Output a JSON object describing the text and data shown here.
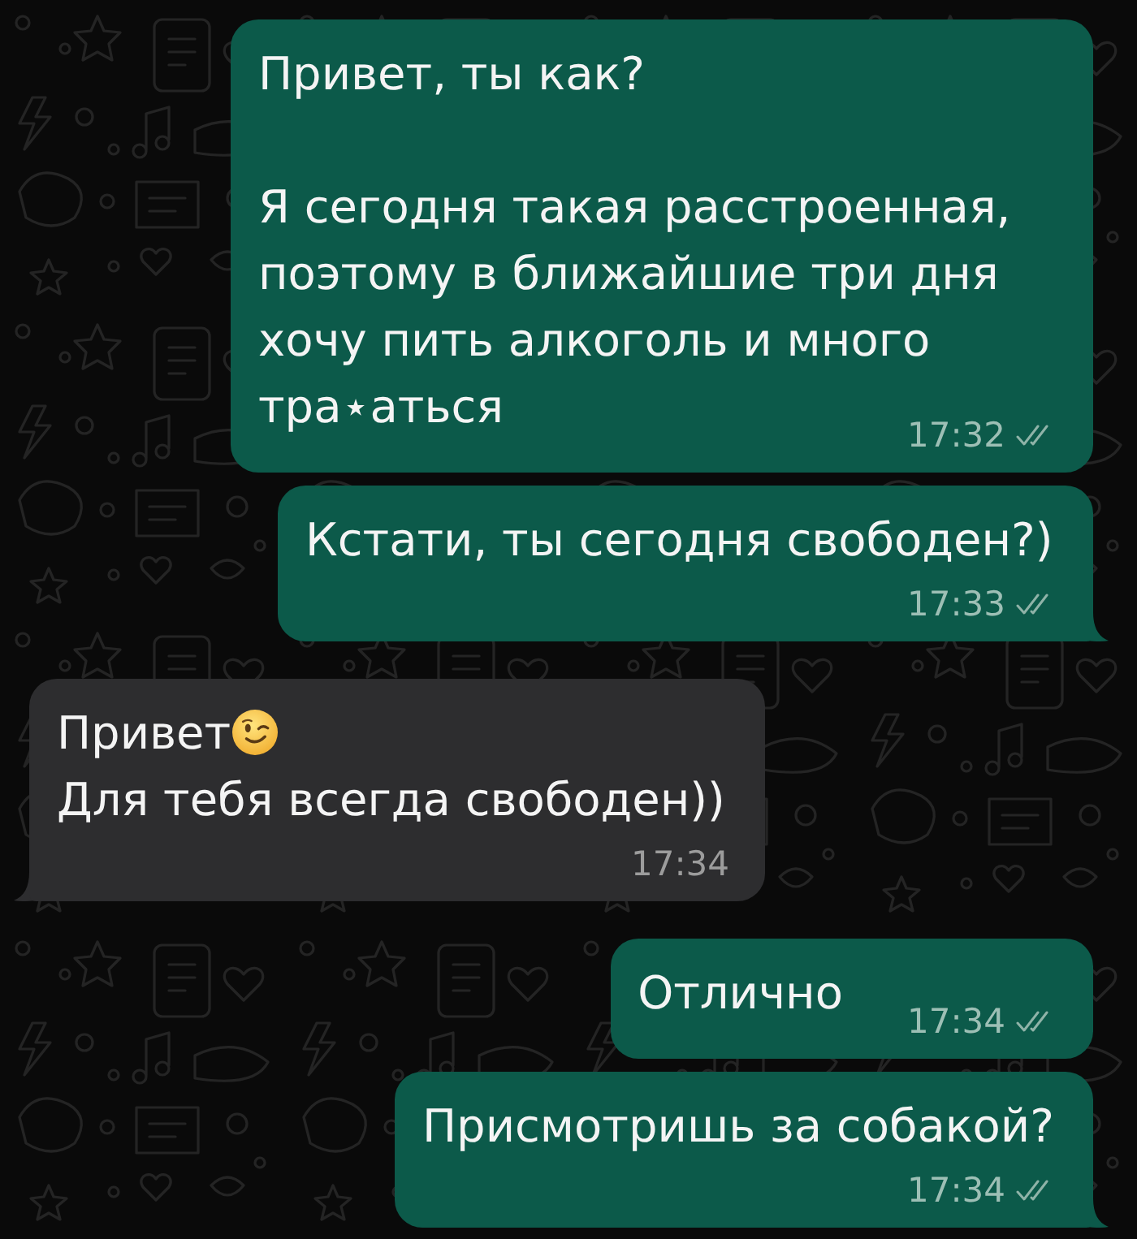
{
  "messages": [
    {
      "kind": "outgoing",
      "parts": [
        {
          "kind": "text",
          "text": "Привет, ты как?\n\nЯ сегодня такая расстроенная, поэтому в ближайшие три дня хочу пить алкоголь и много тра⋆аться"
        }
      ],
      "time": "17:32",
      "read": false,
      "tail": false
    },
    {
      "kind": "outgoing",
      "parts": [
        {
          "kind": "text",
          "text": "Кстати, ты сегодня свободен?)"
        }
      ],
      "time": "17:33",
      "read": false,
      "tail": true
    },
    {
      "kind": "incoming",
      "parts": [
        {
          "kind": "text",
          "text": "Привет"
        },
        {
          "kind": "emoji"
        },
        {
          "kind": "text",
          "text": "\nДля тебя всегда свободен))"
        }
      ],
      "time": "17:34",
      "tail": true
    },
    {
      "kind": "outgoing",
      "parts": [
        {
          "kind": "text",
          "text": "Отлично"
        }
      ],
      "time": "17:34",
      "read": false,
      "tail": false
    },
    {
      "kind": "outgoing",
      "parts": [
        {
          "kind": "text",
          "text": "Присмотришь за собакой?"
        }
      ],
      "time": "17:34",
      "read": false,
      "tail": true
    }
  ]
}
